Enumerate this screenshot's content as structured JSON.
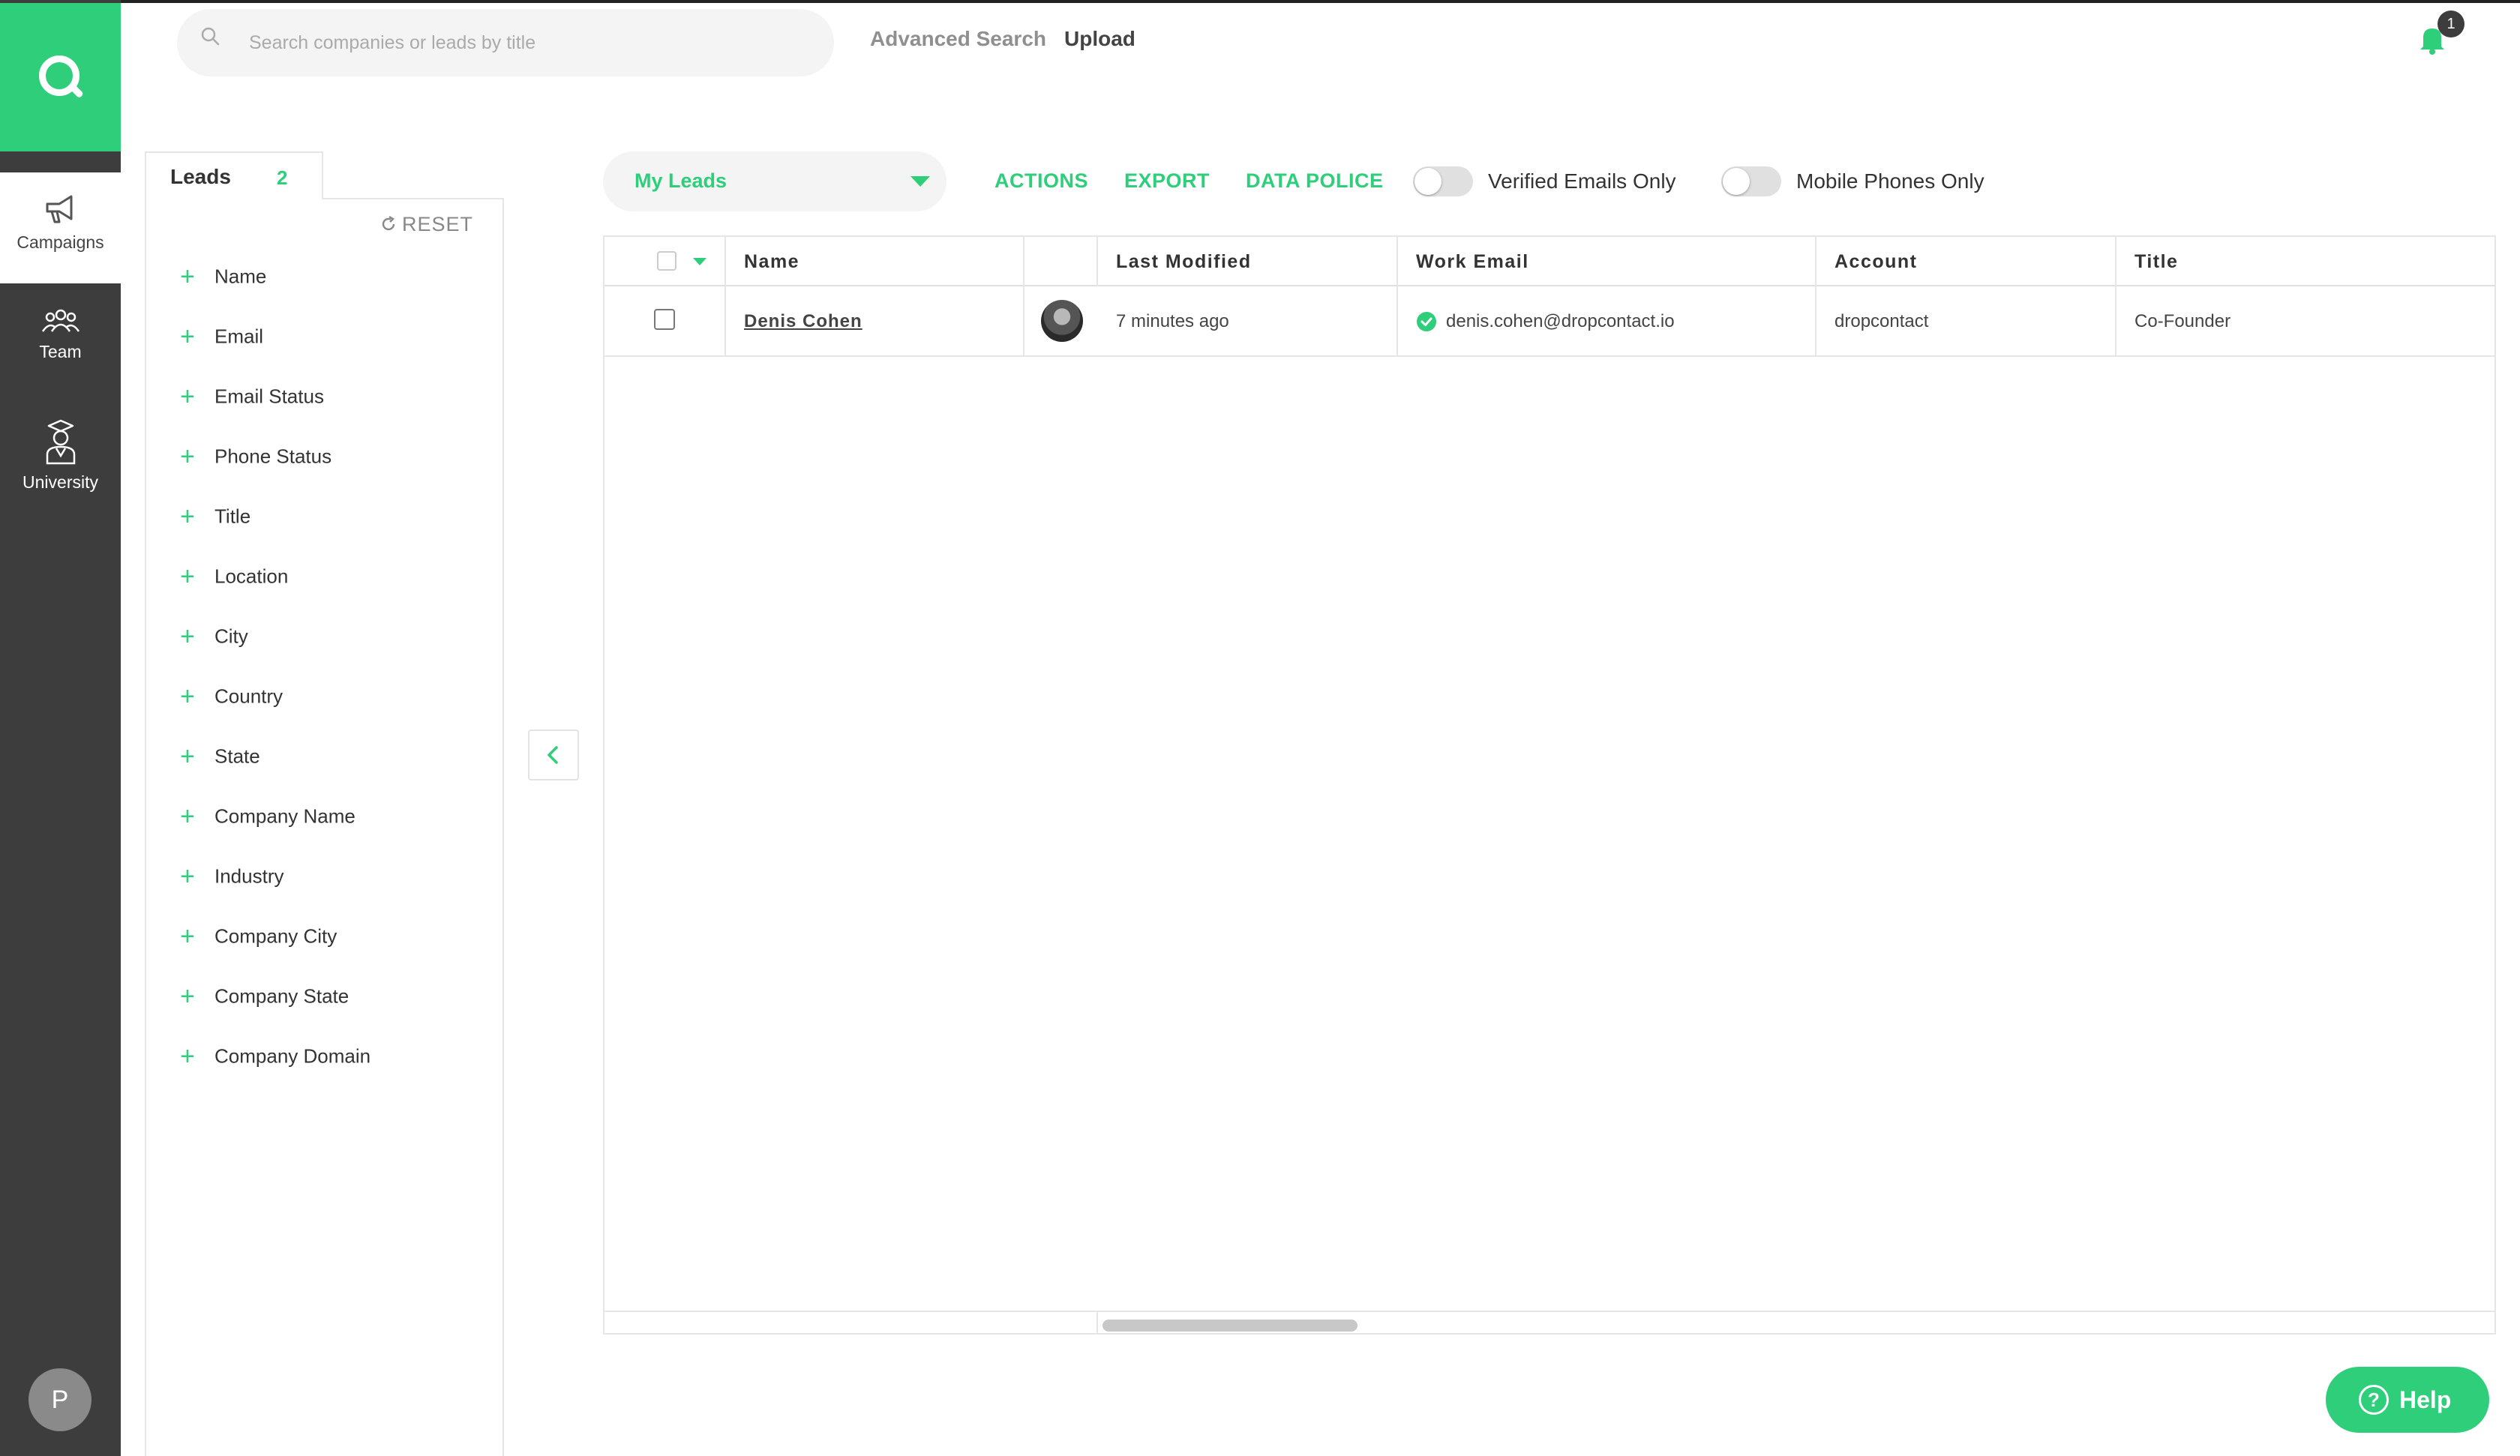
{
  "sidebar": {
    "items": [
      {
        "label": "Campaigns",
        "icon": "megaphone-icon"
      },
      {
        "label": "Team",
        "icon": "team-icon"
      },
      {
        "label": "University",
        "icon": "graduate-icon"
      }
    ],
    "avatar_initial": "P"
  },
  "header": {
    "search_placeholder": "Search companies or leads by title",
    "advanced_search": "Advanced Search",
    "upload": "Upload",
    "notification_count": "1"
  },
  "filters": {
    "tab_label": "Leads",
    "tab_count": "2",
    "reset_label": "RESET",
    "items": [
      "Name",
      "Email",
      "Email Status",
      "Phone Status",
      "Title",
      "Location",
      "City",
      "Country",
      "State",
      "Company Name",
      "Industry",
      "Company City",
      "Company State",
      "Company Domain"
    ]
  },
  "toolbar": {
    "list_select": "My Leads",
    "actions": "ACTIONS",
    "export": "EXPORT",
    "data_police": "DATA POLICE",
    "verified_emails_only": "Verified Emails Only",
    "mobile_phones_only": "Mobile Phones Only",
    "verified_toggle_on": false,
    "mobile_toggle_on": false
  },
  "table": {
    "columns": [
      "Name",
      "Last Modified",
      "Work Email",
      "Account",
      "Title"
    ],
    "rows": [
      {
        "name": "Denis Cohen",
        "last_modified": "7 minutes ago",
        "work_email": "denis.cohen@dropcontact.io",
        "account": "dropcontact",
        "title": "Co-Founder",
        "email_verified": true
      }
    ]
  },
  "help": {
    "label": "Help"
  },
  "colors": {
    "accent": "#2ece7a",
    "sidebar": "#3d3d3d"
  }
}
